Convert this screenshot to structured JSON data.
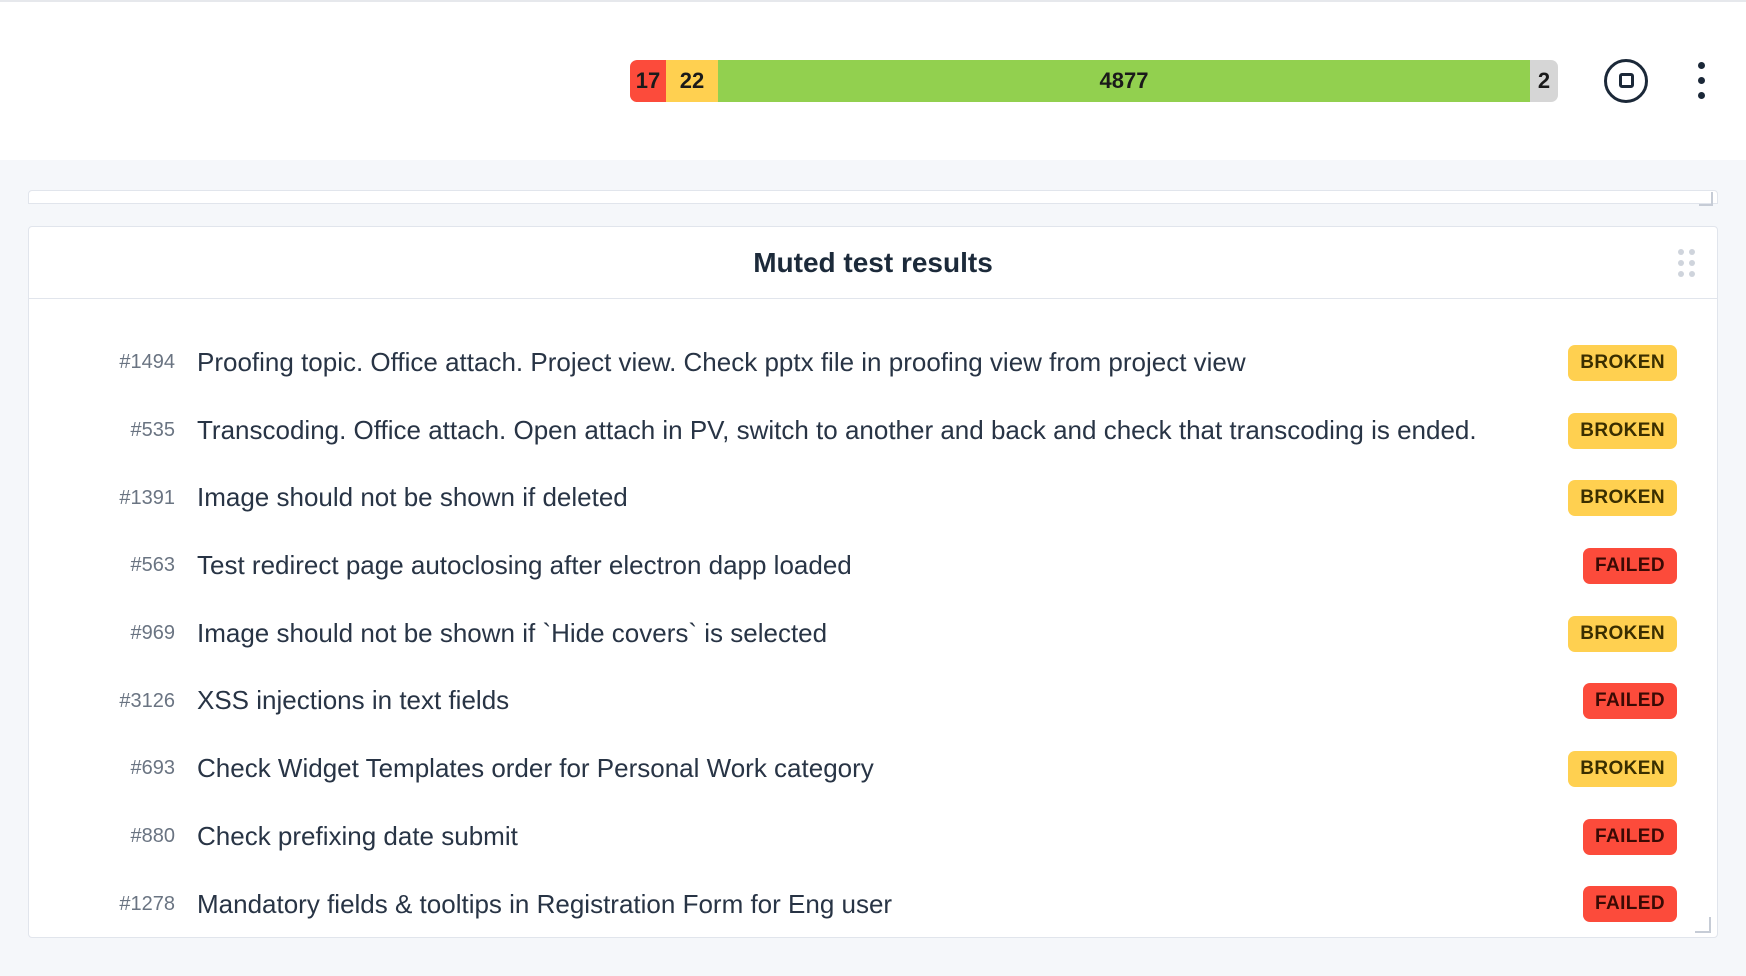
{
  "summary": {
    "failed": "17",
    "broken": "22",
    "passed": "4877",
    "skipped": "2"
  },
  "panel": {
    "title": "Muted test results"
  },
  "rows": [
    {
      "id": "#1494",
      "title": "Proofing topic. Office attach. Project view. Check pptx file in proofing view from project view",
      "status": "BROKEN"
    },
    {
      "id": "#535",
      "title": "Transcoding. Office attach. Open attach in PV, switch to another and back and check that transcoding is ended.",
      "status": "BROKEN"
    },
    {
      "id": "#1391",
      "title": "Image should not be shown if deleted",
      "status": "BROKEN"
    },
    {
      "id": "#563",
      "title": "Test redirect page autoclosing after electron dapp loaded",
      "status": "FAILED"
    },
    {
      "id": "#969",
      "title": "Image should not be shown if `Hide covers` is selected",
      "status": "BROKEN"
    },
    {
      "id": "#3126",
      "title": "XSS injections in text fields",
      "status": "FAILED"
    },
    {
      "id": "#693",
      "title": "Check Widget Templates order for Personal Work category",
      "status": "BROKEN"
    },
    {
      "id": "#880",
      "title": "Check prefixing date submit",
      "status": "FAILED"
    },
    {
      "id": "#1278",
      "title": "Mandatory fields & tooltips in Registration Form for Eng user",
      "status": "FAILED"
    }
  ],
  "statusLabels": {
    "BROKEN": "BROKEN",
    "FAILED": "FAILED"
  }
}
